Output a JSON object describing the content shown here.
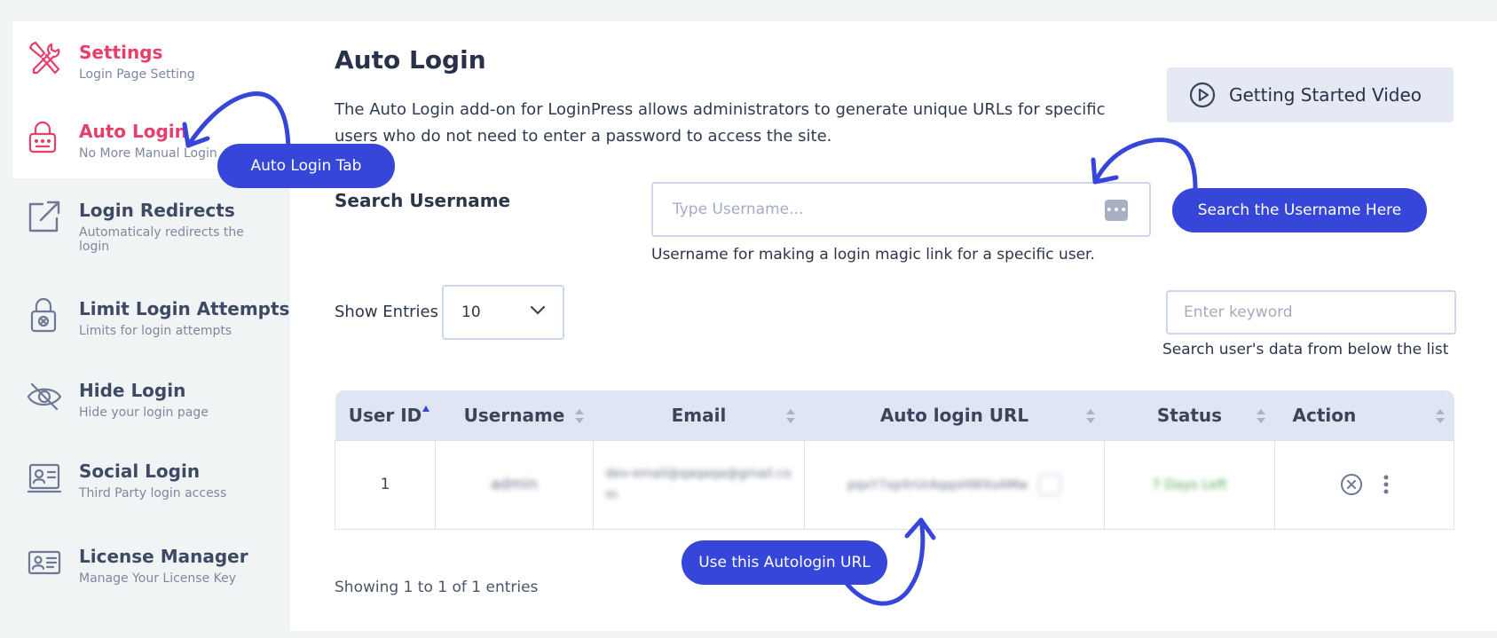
{
  "sidebar": {
    "items": [
      {
        "title": "Settings",
        "subtitle": "Login Page Setting",
        "icon": "tools-icon"
      },
      {
        "title": "Auto Login",
        "subtitle": "No More Manual Login",
        "icon": "lock-keyboard-icon"
      },
      {
        "title": "Login Redirects",
        "subtitle": "Automaticaly redirects the login",
        "icon": "external-link-icon"
      },
      {
        "title": "Limit Login Attempts",
        "subtitle": "Limits for login attempts",
        "icon": "padlock-icon"
      },
      {
        "title": "Hide Login",
        "subtitle": "Hide your login page",
        "icon": "eye-slash-icon"
      },
      {
        "title": "Social Login",
        "subtitle": "Third Party login access",
        "icon": "id-card-icon"
      },
      {
        "title": "License Manager",
        "subtitle": "Manage Your License Key",
        "icon": "license-card-icon"
      }
    ]
  },
  "main": {
    "title": "Auto Login",
    "description": "The Auto Login add-on for LoginPress allows administrators to generate unique URLs for specific users who do not need to enter a password to access the site.",
    "video_button": "Getting Started Video",
    "search_label": "Search Username",
    "username_placeholder": "Type Username...",
    "username_help": "Username for making a login magic link for a specific user.",
    "show_entries_label": "Show Entries",
    "show_entries_value": "10",
    "keyword_placeholder": "Enter keyword",
    "keyword_help": "Search user's data from below the list",
    "table": {
      "columns": [
        "User ID",
        "Username",
        "Email",
        "Auto login URL",
        "Status",
        "Action"
      ],
      "rows": [
        {
          "id": "1",
          "username": "admin",
          "email": "dev-email@qaqaqa@gmail.com",
          "url": "pqxY7xpXrUrAqqoHWXoAMw",
          "status": "7 Days Left"
        }
      ]
    },
    "showing_text": "Showing 1 to 1 of 1 entries"
  },
  "annotations": {
    "auto_login_tab": "Auto Login Tab",
    "search_here": "Search the Username Here",
    "use_url": "Use this Autologin URL"
  },
  "colors": {
    "accent_pink": "#e83e6c",
    "annotation_blue": "#3646d8",
    "table_header": "#dfe5f3"
  }
}
